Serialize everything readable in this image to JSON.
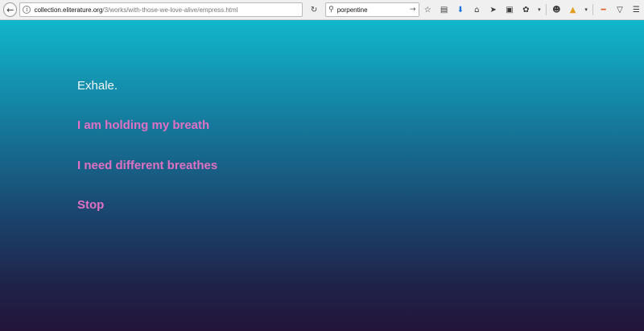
{
  "browser": {
    "url_host": "collection.eliterature.org",
    "url_path": "/3/works/with-those-we-love-alive/empress.html",
    "url_prefix": "",
    "search_value": "porpentine",
    "icons": {
      "back": "back-arrow-icon",
      "info": "info-icon",
      "reload": "reload-icon",
      "search": "search-icon",
      "search_go": "arrow-right-icon",
      "toolbar": [
        "bookmark-star-icon",
        "clipboard-icon",
        "download-icon",
        "home-icon",
        "send-icon",
        "screenshot-icon",
        "extension-icon",
        "dropdown-icon",
        "smiley-icon",
        "drive-icon",
        "dropdown-icon",
        "extension-icon",
        "pocket-icon",
        "menu-icon"
      ]
    }
  },
  "story": {
    "prompt": "Exhale.",
    "choices": [
      "I am holding my breath",
      "I need different breathes",
      "Stop"
    ]
  },
  "colors": {
    "link": "#e070c4",
    "text": "#f2f7fa",
    "gradient_top": "#11b6cc",
    "gradient_bottom": "#23143a"
  }
}
